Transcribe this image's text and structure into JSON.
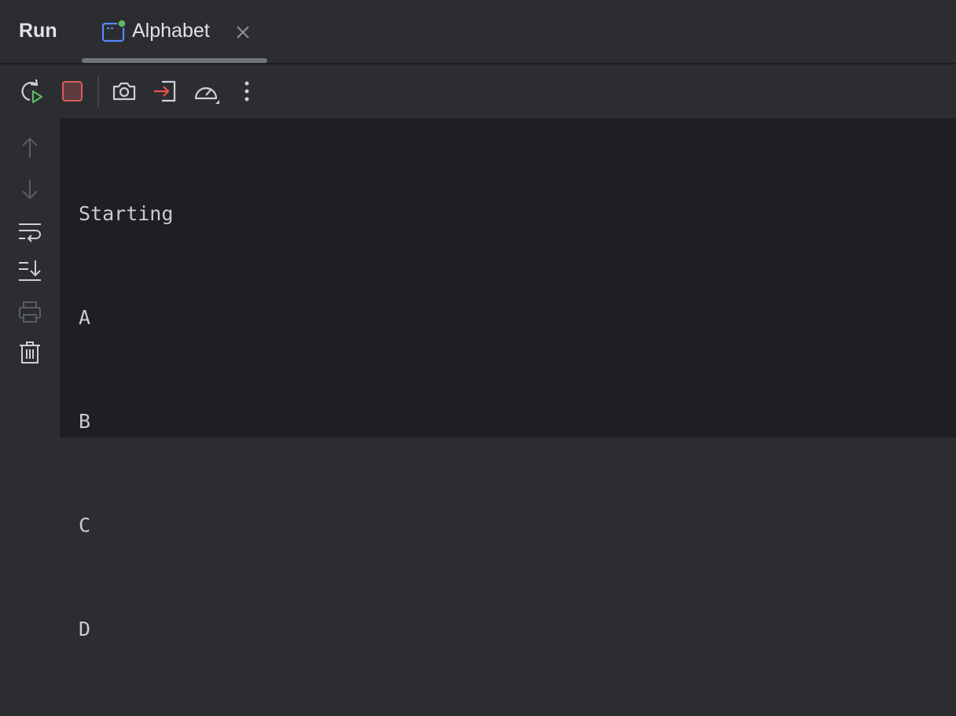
{
  "header": {
    "title": "Run",
    "tab": {
      "label": "Alphabet",
      "icon": "run-configuration-icon",
      "status": "running",
      "status_color": "#5fb865"
    }
  },
  "toolbar": {
    "buttons": [
      {
        "name": "rerun-button",
        "icon": "rerun-icon"
      },
      {
        "name": "stop-button",
        "icon": "stop-icon",
        "color": "#db5c5c"
      },
      {
        "name": "screenshot-button",
        "icon": "camera-icon"
      },
      {
        "name": "attach-debugger-button",
        "icon": "login-arrow-icon",
        "color": "#e5534b"
      },
      {
        "name": "profiler-button",
        "icon": "speedometer-icon"
      },
      {
        "name": "more-options-button",
        "icon": "vertical-ellipsis-icon"
      }
    ]
  },
  "sidebar": {
    "buttons": [
      {
        "name": "scroll-up-button",
        "icon": "arrow-up-icon",
        "enabled": false
      },
      {
        "name": "scroll-down-button",
        "icon": "arrow-down-icon",
        "enabled": false
      },
      {
        "name": "soft-wrap-button",
        "icon": "soft-wrap-icon",
        "enabled": true
      },
      {
        "name": "scroll-to-end-button",
        "icon": "scroll-to-end-icon",
        "enabled": true
      },
      {
        "name": "print-button",
        "icon": "printer-icon",
        "enabled": false
      },
      {
        "name": "clear-all-button",
        "icon": "trash-icon",
        "enabled": true
      }
    ]
  },
  "console": {
    "lines": [
      "Starting",
      "A",
      "B",
      "C",
      "D"
    ]
  }
}
